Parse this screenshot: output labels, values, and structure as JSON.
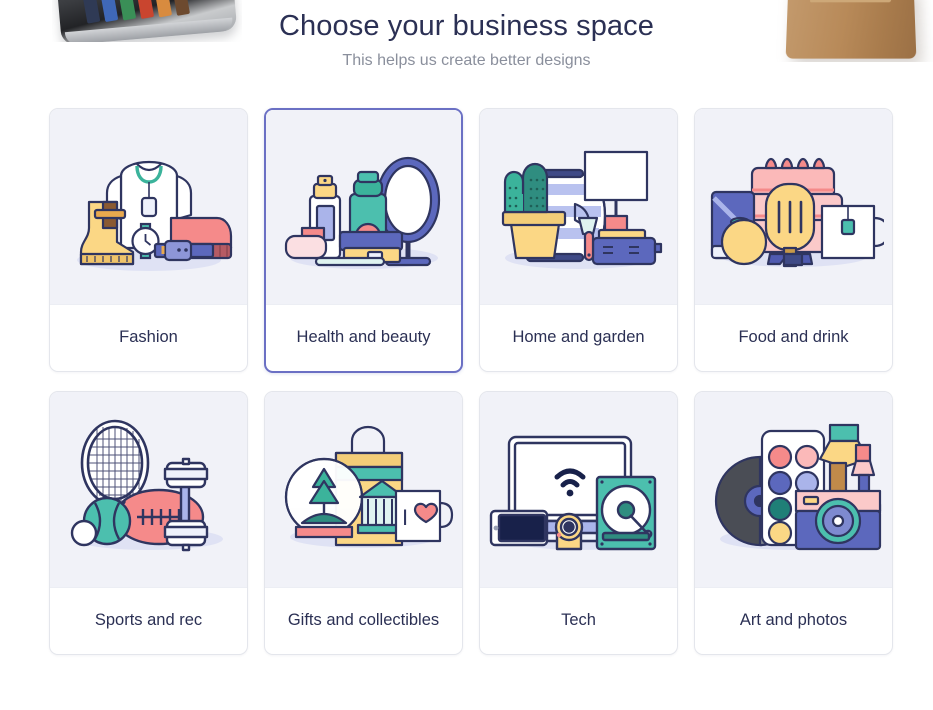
{
  "header": {
    "title": "Choose your business space",
    "subtitle": "This helps us create better designs"
  },
  "decorations": [
    {
      "name": "pencil-tin-photo",
      "description": "metal tin with colored pencils, cropped at top-left"
    },
    {
      "name": "wooden-box-photo",
      "description": "wooden box, cropped at top-right"
    }
  ],
  "colors": {
    "page_background": "#ffffff",
    "card_background": "#ffffff",
    "card_art_background": "#f1f2f8",
    "card_border": "#e4e6ec",
    "selected_border": "#6b70c4",
    "title_text": "#2b3054",
    "subtitle_text": "#8a8f9c",
    "ink": "#2f3560",
    "accent_blue": "#5c68bd",
    "accent_teal": "#4cbfae",
    "accent_yellow": "#fbd785",
    "accent_pink": "#f58a8a",
    "accent_lavender": "#aab4ea"
  },
  "grid": {
    "columns": 4,
    "rows": 2,
    "cards": [
      {
        "id": "fashion",
        "label": "Fashion",
        "icon": "fashion-illustration",
        "selected": false
      },
      {
        "id": "health",
        "label": "Health and beauty",
        "icon": "health-illustration",
        "selected": true
      },
      {
        "id": "home",
        "label": "Home and garden",
        "icon": "home-garden-illustration",
        "selected": false
      },
      {
        "id": "food",
        "label": "Food and drink",
        "icon": "food-drink-illustration",
        "selected": false
      },
      {
        "id": "sports",
        "label": "Sports and rec",
        "icon": "sports-illustration",
        "selected": false
      },
      {
        "id": "gifts",
        "label": "Gifts and collectibles",
        "icon": "gifts-illustration",
        "selected": false
      },
      {
        "id": "tech",
        "label": "Tech",
        "icon": "tech-illustration",
        "selected": false
      },
      {
        "id": "art",
        "label": "Art and photos",
        "icon": "art-photos-illustration",
        "selected": false
      }
    ]
  },
  "mug_text": "I"
}
